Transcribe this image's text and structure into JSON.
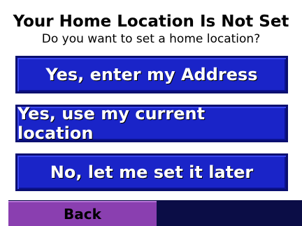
{
  "prompt": {
    "title": "Your Home Location Is Not Set",
    "subtitle": "Do you want to set a home location?"
  },
  "options": [
    {
      "label": "Yes, enter my Address"
    },
    {
      "label": "Yes, use my current location"
    },
    {
      "label": "No, let me set it later"
    }
  ],
  "footer": {
    "back_label": "Back"
  },
  "colors": {
    "button_blue": "#1a24c8",
    "back_purple": "#8a3fb0",
    "footer_navy": "#0b0d46"
  }
}
